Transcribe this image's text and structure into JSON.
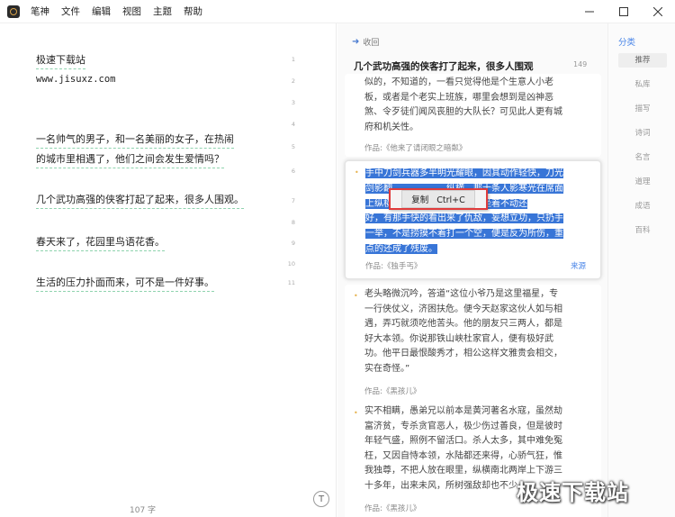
{
  "menu": [
    "笔神",
    "文件",
    "编辑",
    "视图",
    "主题",
    "帮助"
  ],
  "window_controls": [
    "minimize",
    "maximize",
    "close"
  ],
  "editor": {
    "lines": [
      {
        "no": "1",
        "text": "极速下载站"
      },
      {
        "no": "2",
        "text": "www.jisuxz.com"
      },
      {
        "no": "3",
        "text": ""
      },
      {
        "no": "4",
        "text": ""
      },
      {
        "no": "5",
        "text": "一名帅气的男子，和一名美丽的女子，在热闹"
      },
      {
        "no": "6",
        "text": "的城市里相遇了，他们之间会发生爱情吗？"
      },
      {
        "no": "7",
        "text": "几个武功高强的侠客打起了起来，很多人围观。"
      },
      {
        "no": "8",
        "text": ""
      },
      {
        "no": "9",
        "text": "春天来了，花园里鸟语花香。"
      },
      {
        "no": "10",
        "text": ""
      },
      {
        "no": "11",
        "text": "生活的压力扑面而来，可不是一件好事。"
      }
    ],
    "word_count": "107 字",
    "template_icon_glyph": "T"
  },
  "results": {
    "collapse_label": "收回",
    "query_title": "几个武功高强的侠客打了起来，很多人围观",
    "query_count": "149",
    "card1": {
      "lines": [
        "似的，不知道的，一看只觉得他是个生意人小老",
        "板，或者是个老实上班族，哪里会想到是凶神恶",
        "煞、令歹徒们闻风丧胆的大队长？可见此人更有城",
        "府和机关性。"
      ],
      "source": "作品:《他来了请闭眼之暗粼》"
    },
    "card2": {
      "lines": [
        "手中刀剑兵器多半明光耀眼，因其动作轻快，刀光",
        "剑影翻",
        "纵横，那十条人影寒光在席面",
        "上纵横",
        "之处群贼坐着不动还",
        "好，有那手快的看出来了仇敌，妄想立功，只扔手",
        "一举，不是捞摸不着打一个空，便是反为所伤，重",
        "点的还成了残废。"
      ],
      "source": "作品:《独手丐》",
      "source_link": "来源"
    },
    "context_menu": {
      "copy_label": "复制",
      "shortcut": "Ctrl+C"
    },
    "card3": {
      "lines": [
        "老头略微沉吟，答道“这位小爷乃是这里福星，专",
        "一行侠仗义，济困扶危。便今天赵家这伙人如与相",
        "遇，弄巧就须吃他苦头。他的朋友只三两人，都是",
        "好大本领。你说那铁山峡杜家官人，便有极好武",
        "功。他平日最恨酸秀才，相公这样文雅贵会相交，",
        "实在奇怪。”"
      ],
      "source": "作品:《黑孩儿》"
    },
    "card4": {
      "lines": [
        "实不相瞒，愚弟兄以前本是黄河著名水寇，虽然劫",
        "富济贫，专杀贪官恶人，极少伤过善良，但是彼时",
        "年轻气盛，照例不留活口。杀人太多，其中难免冤",
        "枉，又因自恃本领，水陆都还来得，心骄气狂，惟",
        "我独尊，不把人放在眼里，纵横南北两岸上下游三",
        "十多年，出来未风，所树强敌却也不少。"
      ],
      "source": "作品:《黑孩儿》"
    }
  },
  "sidebar": {
    "heading": "分类",
    "items": [
      "推荐",
      "私库",
      "描写",
      "诗词",
      "名言",
      "道理",
      "成语",
      "百科"
    ],
    "selected_index": 0
  },
  "watermark": "极速下载站",
  "colors": {
    "accent": "#4a86e8",
    "selection": "#3875d7",
    "underline": "#8fd3ae",
    "highlight_box": "#e03c3c",
    "bullet": "#e6b34f"
  }
}
